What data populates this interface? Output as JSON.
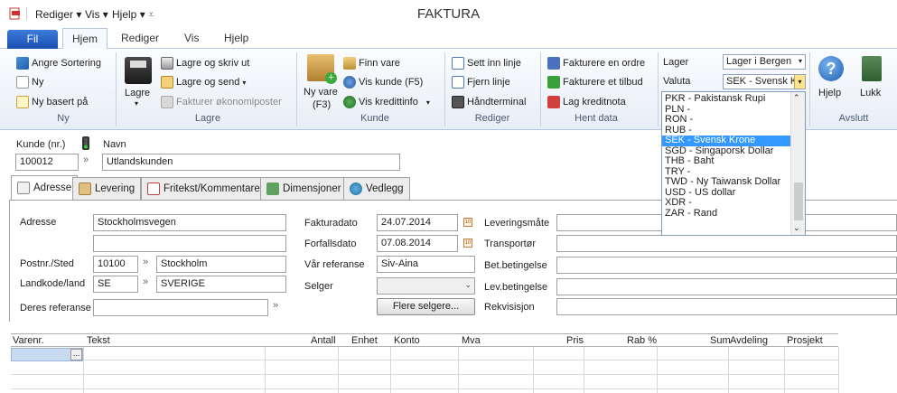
{
  "window": {
    "title": "FAKTURA",
    "quick_access": [
      "Rediger",
      "Vis",
      "Hjelp"
    ]
  },
  "ribbon_tabs": {
    "file": "Fil",
    "items": [
      "Hjem",
      "Rediger",
      "Vis",
      "Hjelp"
    ]
  },
  "ribbon": {
    "ny": {
      "label": "Ny",
      "items": [
        "Angre Sortering",
        "Ny",
        "Ny basert på"
      ]
    },
    "lagre": {
      "label": "Lagre",
      "big": "Lagre",
      "items": [
        "Lagre og skriv ut",
        "Lagre og send",
        "Fakturer økonomiposter"
      ]
    },
    "kunde": {
      "label": "Kunde",
      "big_line1": "Ny vare",
      "big_line2": "(F3)",
      "items": [
        "Finn vare",
        "Vis kunde (F5)",
        "Vis kredittinfo"
      ]
    },
    "rediger": {
      "label": "Rediger",
      "items": [
        "Sett inn linje",
        "Fjern linje",
        "Håndterminal"
      ]
    },
    "hent": {
      "label": "Hent data",
      "items": [
        "Fakturere en ordre",
        "Fakturere et tilbud",
        "Lag kreditnota"
      ]
    },
    "lager_label": "Lager",
    "lager_value": "Lager i Bergen",
    "valuta_label": "Valuta",
    "valuta_value": "SEK - Svensk K",
    "avslutt": {
      "label": "Avslutt",
      "hjelp": "Hjelp",
      "lukk": "Lukk"
    }
  },
  "currency_dropdown": {
    "options": [
      "PKR - Pakistansk Rupi",
      "PLN -",
      "RON -",
      "RUB -",
      "SEK - Svensk Krone",
      "SGD - Singaporsk Dollar",
      "THB - Baht",
      "TRY -",
      "TWD - Ny Taiwansk Dollar",
      "USD - US dollar",
      "XDR -",
      "ZAR - Rand"
    ],
    "selected": "SEK - Svensk Krone"
  },
  "customer": {
    "nr_label": "Kunde (nr.)",
    "nr_value": "100012",
    "name_label": "Navn",
    "name_value": "Utlandskunden"
  },
  "subtabs": [
    "Adresse",
    "Levering",
    "Fritekst/Kommentarer",
    "Dimensjoner",
    "Vedlegg"
  ],
  "address": {
    "adresse_label": "Adresse",
    "adresse_value": "Stockholmsvegen",
    "adresse2_value": "",
    "postnr_label": "Postnr./Sted",
    "postnr_value": "10100",
    "sted_value": "Stockholm",
    "land_label": "Landkode/land",
    "landkode_value": "SE",
    "land_value": "SVERIGE",
    "deres_ref_label": "Deres referanse",
    "deres_ref_value": ""
  },
  "invoice": {
    "fakturadato_label": "Fakturadato",
    "fakturadato_value": "24.07.2014",
    "forfallsdato_label": "Forfallsdato",
    "forfallsdato_value": "07.08.2014",
    "var_ref_label": "Vår referanse",
    "var_ref_value": "Siv-Aina",
    "selger_label": "Selger",
    "selger_value": "",
    "flere_selgere": "Flere selgere..."
  },
  "delivery": {
    "labels": [
      "Leveringsmåte",
      "Transportør",
      "Bet.betingelse",
      "Lev.betingelse",
      "Rekvisisjon"
    ]
  },
  "grid": {
    "columns": [
      "Varenr.",
      "Tekst",
      "Antall",
      "Enhet",
      "Konto",
      "Mva",
      "Pris",
      "Rab %",
      "Sum",
      "Avdeling",
      "Prosjekt"
    ],
    "cell_button": "..."
  },
  "colors": {
    "accent": "#2b5fc1",
    "selection": "#3399ff"
  }
}
